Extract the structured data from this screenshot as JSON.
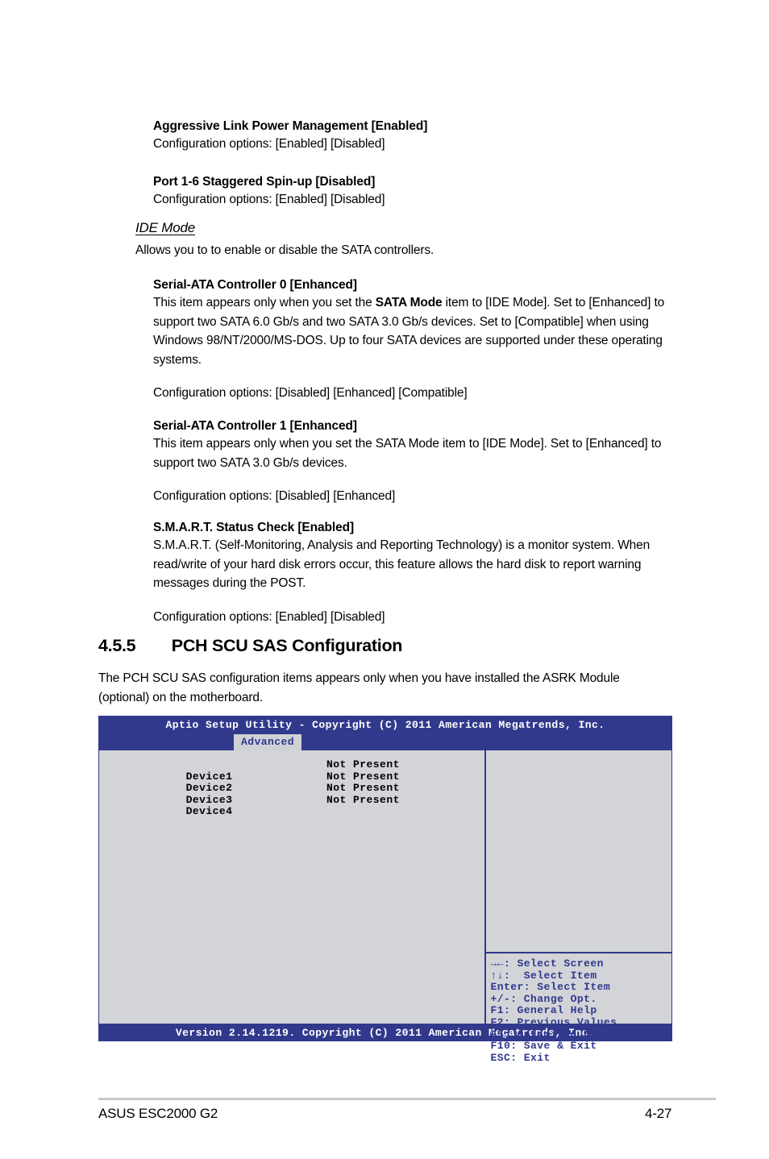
{
  "doc": {
    "items": [
      {
        "title": "Aggressive Link Power Management [Enabled]",
        "body": "Configuration options: [Enabled] [Disabled]"
      },
      {
        "title": "Port 1-6 Staggered Spin-up [Disabled]",
        "body": "Configuration options: [Enabled] [Disabled]"
      }
    ],
    "ide_mode": {
      "heading": "IDE Mode",
      "description": "Allows you to to enable or disable the SATA controllers."
    },
    "sata0": {
      "title": "Serial-ATA Controller 0 [Enhanced]",
      "body_pre": "This item appears only when you set the ",
      "body_bold": "SATA Mode",
      "body_post": " item to [IDE Mode]. Set to [Enhanced] to support two SATA 6.0 Gb/s and two SATA 3.0 Gb/s devices. Set to [Compatible] when using Windows 98/NT/2000/MS-DOS. Up to four SATA devices are supported under these operating systems.",
      "options": "Configuration options: [Disabled] [Enhanced] [Compatible]"
    },
    "sata1": {
      "title": "Serial-ATA Controller 1 [Enhanced]",
      "body": "This item appears only when you set the SATA Mode item to [IDE Mode]. Set to [Enhanced] to support two SATA 3.0 Gb/s devices.",
      "options": "Configuration options: [Disabled] [Enhanced]"
    },
    "smart": {
      "title": "S.M.A.R.T. Status Check [Enabled]",
      "body": "S.M.A.R.T. (Self-Monitoring, Analysis and Reporting Technology) is a monitor system. When read/write of your hard disk errors occur, this feature allows the hard disk to report warning messages during the POST.",
      "options": "Configuration options: [Enabled] [Disabled]"
    },
    "section": {
      "number": "4.5.5",
      "title": "PCH SCU SAS Configuration",
      "intro": "The PCH SCU SAS configuration items appears only when you have installed the ASRK Module (optional) on the motherboard."
    }
  },
  "bios": {
    "title": "Aptio Setup Utility - Copyright (C) 2011 American Megatrends, Inc.",
    "active_tab": "Advanced",
    "devices": [
      {
        "name": "Device1",
        "status": "Not Present"
      },
      {
        "name": "Device2",
        "status": "Not Present"
      },
      {
        "name": "Device3",
        "status": "Not Present"
      },
      {
        "name": "Device4",
        "status": "Not Present"
      }
    ],
    "help_keys": [
      "→←: Select Screen",
      "↑↓:  Select Item",
      "Enter: Select Item",
      "+/-: Change Opt.",
      "F1: General Help",
      "F2: Previous Values",
      "F5: Optimized Defaults",
      "F10: Save & Exit",
      "ESC: Exit"
    ],
    "version": "Version 2.14.1219. Copyright (C) 2011 American Megatrends, Inc.",
    "colors": {
      "bar": "#31398c",
      "panel": "#d2d4d8",
      "tab_bg": "#cfd1d6"
    }
  },
  "footer": {
    "product": "ASUS ESC2000 G2",
    "page": "4-27"
  }
}
